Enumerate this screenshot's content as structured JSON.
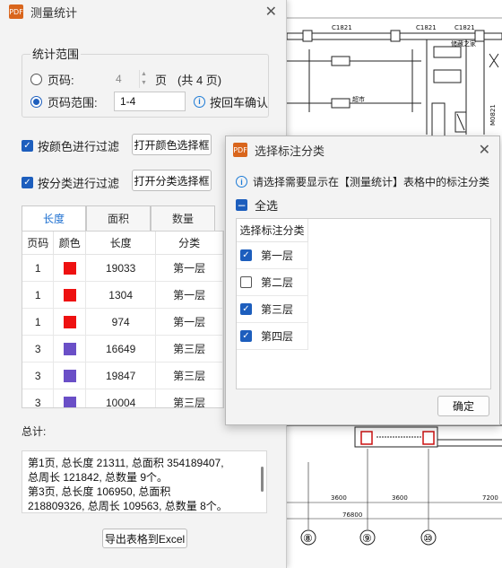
{
  "measure_window": {
    "title": "测量统计",
    "app_icon_text": "PDF",
    "range_group_label": "统计范围",
    "page_label": "页码:",
    "page_value": "4",
    "page_unit": "页",
    "page_total": "(共 4 页)",
    "range_label": "页码范围:",
    "range_value": "1-4",
    "enter_hint": "按回车确认",
    "color_filter_label": "按颜色进行过滤",
    "color_filter_button": "打开颜色选择框",
    "class_filter_label": "按分类进行过滤",
    "class_filter_button": "打开分类选择框",
    "tabs": [
      "长度",
      "面积",
      "数量"
    ],
    "table_headers": [
      "页码",
      "颜色",
      "长度",
      "分类"
    ],
    "rows": [
      {
        "page": "1",
        "color": "#ee1111",
        "length": "19033",
        "category": "第一层"
      },
      {
        "page": "1",
        "color": "#ee1111",
        "length": "1304",
        "category": "第一层"
      },
      {
        "page": "1",
        "color": "#ee1111",
        "length": "974",
        "category": "第一层"
      },
      {
        "page": "3",
        "color": "#6a4fc7",
        "length": "16649",
        "category": "第三层"
      },
      {
        "page": "3",
        "color": "#6a4fc7",
        "length": "19847",
        "category": "第三层"
      },
      {
        "page": "3",
        "color": "#6a4fc7",
        "length": "10004",
        "category": "第三层"
      }
    ],
    "total_label": "总计:",
    "summary_lines": [
      "第1页, 总长度 21311, 总面积 354189407,",
      "总周长 121842, 总数量 9个。",
      "第3页, 总长度 106950, 总面积",
      "218809326, 总周长 109563, 总数量 8个。"
    ],
    "export_button": "导出表格到Excel"
  },
  "category_dialog": {
    "title": "选择标注分类",
    "info_text": "请选择需要显示在【测量统计】表格中的标注分类",
    "select_all_label": "全选",
    "list_header": "选择标注分类",
    "items": [
      {
        "label": "第一层",
        "checked": true
      },
      {
        "label": "第二层",
        "checked": false
      },
      {
        "label": "第三层",
        "checked": true
      },
      {
        "label": "第四层",
        "checked": true
      }
    ],
    "ok_button": "确定"
  },
  "cad": {
    "labels": [
      "C1821",
      "C1821",
      "C1821",
      "储藏之家",
      "超市",
      "M0821",
      "3600",
      "3600",
      "7200",
      "76800",
      "⑧",
      "⑨",
      "⑩"
    ]
  }
}
